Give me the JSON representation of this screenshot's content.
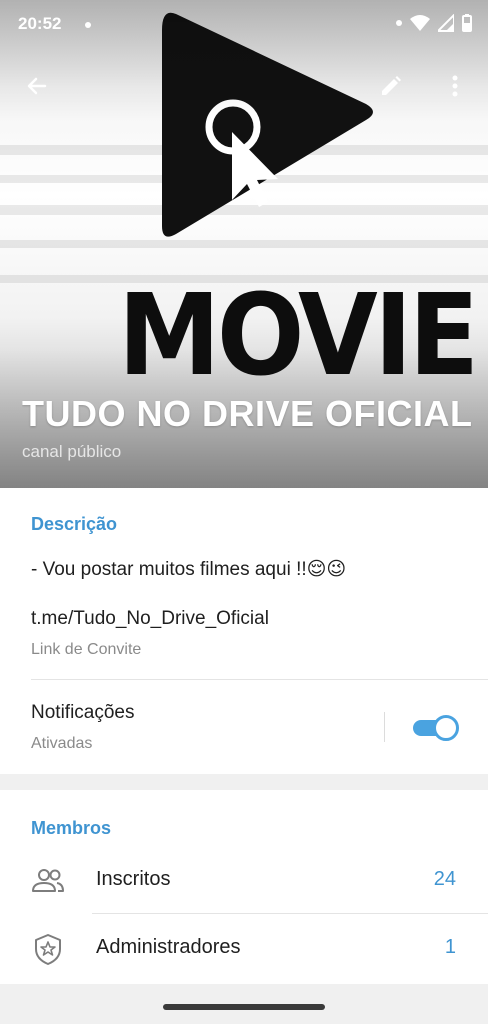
{
  "status_bar": {
    "time": "20:52",
    "icons": [
      "notification-dot-icon",
      "wifi-icon",
      "signal-icon",
      "battery-icon"
    ]
  },
  "toolbar": {
    "back_icon": "arrow-left-icon",
    "edit_icon": "pencil-icon",
    "more_icon": "more-vertical-icon"
  },
  "channel": {
    "logo_text": "MOVIE",
    "title": "TUDO NO DRIVE OFICIAL",
    "subtitle": "canal público"
  },
  "description": {
    "section_title": "Descrição",
    "text": "- Vou postar muitos filmes aqui !!😌😉"
  },
  "invite_link": {
    "url": "t.me/Tudo_No_Drive_Oficial",
    "label": "Link de Convite"
  },
  "notifications": {
    "label": "Notificações",
    "status": "Ativadas",
    "enabled": true
  },
  "members": {
    "section_title": "Membros",
    "rows": [
      {
        "label": "Inscritos",
        "count": "24",
        "icon": "users-icon"
      },
      {
        "label": "Administradores",
        "count": "1",
        "icon": "shield-star-icon"
      }
    ]
  },
  "colors": {
    "accent": "#3f94d1",
    "toggle_on": "#4aa3e0",
    "text_primary": "#1f1f1f",
    "text_secondary": "#8a8a8a"
  }
}
